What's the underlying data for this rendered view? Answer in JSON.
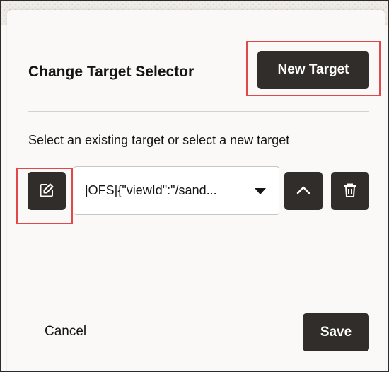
{
  "dialog": {
    "title": "Change Target Selector",
    "new_target_label": "New Target",
    "instruction": "Select an existing target or select a new target",
    "target_select": {
      "selected_value": "|OFS|{\"viewId\":\"/sand..."
    },
    "cancel_label": "Cancel",
    "save_label": "Save"
  },
  "icons": {
    "edit": "edit-icon",
    "dropdown": "caret-down-icon",
    "up": "chevron-up-icon",
    "delete": "trash-icon"
  },
  "colors": {
    "button_dark": "#312d2a",
    "highlight": "#e2474a",
    "background": "#fbf9f8"
  }
}
